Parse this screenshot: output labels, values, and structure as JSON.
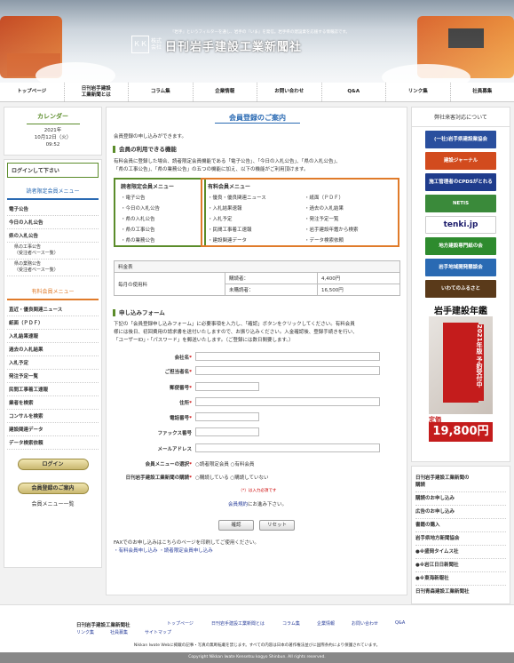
{
  "header": {
    "tagline": "『岩手』というフィルターを通し、岩手の『いま』を発信。岩手県の建設業を応援する情報誌です。",
    "logo_mark": "ＫＫ",
    "logo_kabu": "株式会社",
    "logo_name": "日刊岩手建設工業新聞社"
  },
  "nav": [
    "トップページ",
    "日刊岩手建設\n工業新聞とは",
    "コラム集",
    "企業情報",
    "お問い合わせ",
    "Q&A",
    "リンク集",
    "社員募集"
  ],
  "calendar": {
    "title": "カレンダー",
    "year": "2021年",
    "date": "10月12日（火）",
    "time": "09:52"
  },
  "left_menu": {
    "login_prompt": "ログインして下さい",
    "reader_title": "読者限定会員メニュー",
    "reader_items": [
      "電子公告",
      "今日の入札公告",
      "県の入札公告"
    ],
    "reader_sub": [
      "県の工事公告\n（受注者ベース一覧）",
      "県の業務公告\n（受注者ベース一覧）"
    ],
    "paid_title": "有料会員メニュー",
    "paid_items": [
      "直近・優良関連ニュース",
      "紙面（ＰＤＦ）",
      "入札結果速報",
      "過去の入札結果",
      "入札予定",
      "発注予定一覧",
      "民間工事着工速報",
      "業者を検索",
      "コンサルを検索",
      "建設関連データ",
      "データ検索依頼"
    ],
    "login_button": "ログイン",
    "guide_button": "会員登録のご案内",
    "menu_list": "会員メニュー一覧"
  },
  "main": {
    "title": "会員登録のご案内",
    "intro": "会員登録の申し込みができます。",
    "features_heading": "会員の利用できる機能",
    "features_text1": "有料会員に登録した場合、読者限定会員機能である「電子公告」、「今日の入札公告」、「県の入札公告」、",
    "features_text2": "「県の工事公告」、「県の業務公告」の五つの機能に加え、以下の機能がご利用頂けます。",
    "box_reader_title": "読者限定会員メニュー",
    "box_reader_items": [
      "電子公告",
      "今日の入札公告",
      "県の入札公告",
      "県の工事公告",
      "県の業務公告"
    ],
    "box_paid_title": "有料会員メニュー",
    "box_paid_items": [
      "優良・優良関連ニュース",
      "入札結果速報",
      "入札予定",
      "民間工事着工速報",
      "建設関連データ",
      "紙面（ＰＤＦ）",
      "過去の入札結果",
      "発注予定一覧",
      "岩手建設年鑑から検索",
      "データ検索依頼"
    ],
    "fee": {
      "header": "料金表",
      "label": "毎月の使用料",
      "subscriber": "購読者：",
      "subscriber_price": "4,400円",
      "non_subscriber": "未購読者：",
      "non_subscriber_price": "16,500円"
    },
    "form_heading": "申し込みフォーム",
    "form_text1": "下記の「会員登録申し込みフォーム」に必要事項を入力し、「確認」ボタンをクリックしてください。有料会員",
    "form_text2": "様には後日、初回費用の請求書を送付いたしますので、お振り込みください。入金確認後、登録手続きを行い、",
    "form_text3": "「ユーザーID」・「パスワード」を郵送いたします。（ご登録には数日間要します。）",
    "fields": [
      "会社名",
      "ご担当者名",
      "郵便番号",
      "住所",
      "電話番号",
      "ファックス番号",
      "メールアドレス"
    ],
    "menu_choice_label": "会員メニューの選択",
    "menu_choice_opts": [
      "読者限定会員",
      "有料会員"
    ],
    "sub_label": "日刊岩手建設工業新聞の購読",
    "sub_opts": [
      "購読している",
      "購読していない"
    ],
    "required_note": "（*）は入力必須です",
    "terms_link": "会員規約",
    "terms_suffix": "にお進み下さい。",
    "confirm_button": "確認",
    "reset_button": "リセット",
    "fax_text": "FAXでのお申し込みはこちらのページを印刷してご使用ください。",
    "fax_link1": "・有料会員申し込み",
    "fax_link2": "・読者限定会員申し込み"
  },
  "right": {
    "section_title": "弊社来客対応について",
    "ads": [
      {
        "label": "(一社)岩手県建設業協会",
        "color": "#2a4f9e"
      },
      {
        "label": "建設ジャーナル",
        "color": "#d24b1e"
      },
      {
        "label": "施工管理者のCPDSがとれる",
        "color": "#1f3c8c"
      },
      {
        "label": "NETIS",
        "color": "#3a8a3a"
      },
      {
        "label": "tenki.jp",
        "color": "#ffffff"
      },
      {
        "label": "地方建設専門紙の会",
        "color": "#2e8b2e"
      },
      {
        "label": "岩手地域開発懇談会",
        "color": "#2a6ab3"
      },
      {
        "label": "いわてのふるさと",
        "color": "#5a3a1a"
      }
    ],
    "book_title": "岩手建設年鑑",
    "book_cover": "2021年版 予約受付中",
    "book_teika": "定価",
    "book_price": "19,800円",
    "links": [
      "日刊岩手建設工業新聞の\n購読",
      "購読のお申し込み",
      "広告のお申し込み",
      "書籍の購入",
      "岩手県地方新聞協会",
      "●※盛岡タイムス社",
      "●※岩江日日新聞社",
      "●※東海新報社",
      "日刊青森建設工業新聞社"
    ]
  },
  "footer": {
    "logo": "日刊岩手建設工業新聞社",
    "links": [
      "トップページ",
      "日刊岩手建設工業新聞とは",
      "コラム集",
      "企業情報",
      "お問い合わせ",
      "Q&A",
      "リンク集",
      "社員募集",
      "サイトマップ"
    ],
    "note": "Nikkan Iwate Webに掲載の記事・写真の無断転載を禁じます。すべての内容は日本の著作権法並びに国際条約により保護されています。",
    "copyright": "Copyright Nikkan Iwate Kensetsu kogyo Shinbun. All rights reserved."
  }
}
